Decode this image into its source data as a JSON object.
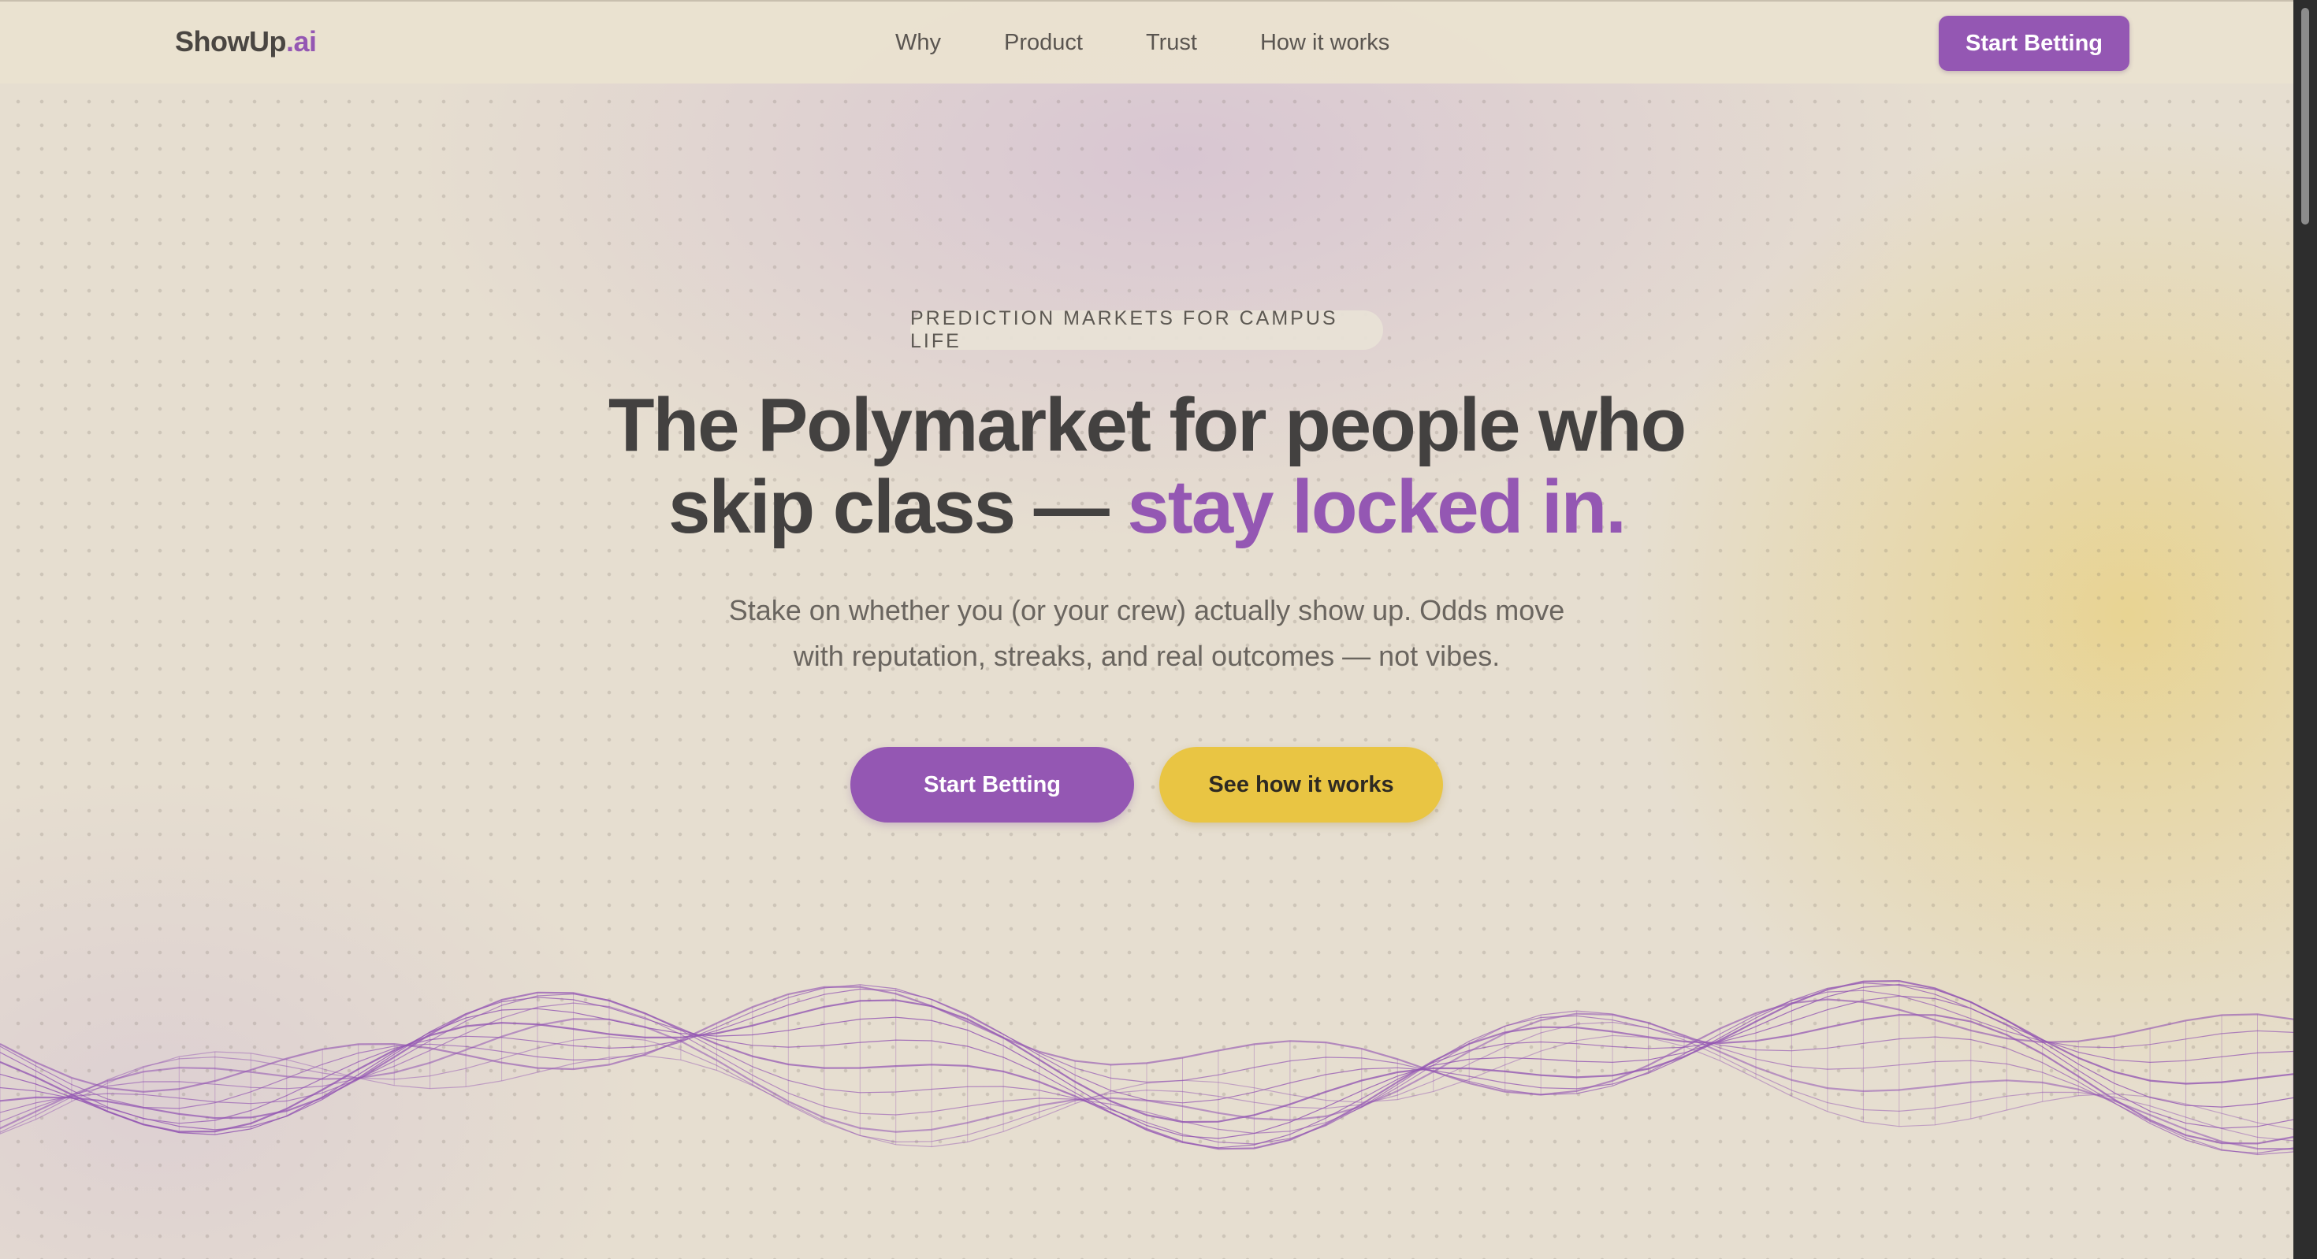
{
  "nav": {
    "logo_main": "ShowUp",
    "logo_accent": ".ai",
    "links": [
      "Why",
      "Product",
      "Trust",
      "How it works"
    ],
    "cta_label": "Start Betting"
  },
  "hero": {
    "eyebrow": "PREDICTION MARKETS FOR CAMPUS LIFE",
    "headline_line1": "The Polymarket for people who",
    "headline_line2_plain": "skip class — ",
    "headline_line2_accent": "stay locked in.",
    "subhead_line1": "Stake on whether you (or your crew) actually show up. Odds move",
    "subhead_line2": "with reputation, streaks, and real outcomes — not vibes.",
    "primary_button": "Start Betting",
    "secondary_button": "See how it works"
  },
  "colors": {
    "accent_purple": "#9457b3",
    "accent_yellow": "#e9c543",
    "text_dark": "#434140",
    "background": "#e6ded0"
  },
  "icons": {
    "decoration": "wireframe-wave-mesh"
  }
}
